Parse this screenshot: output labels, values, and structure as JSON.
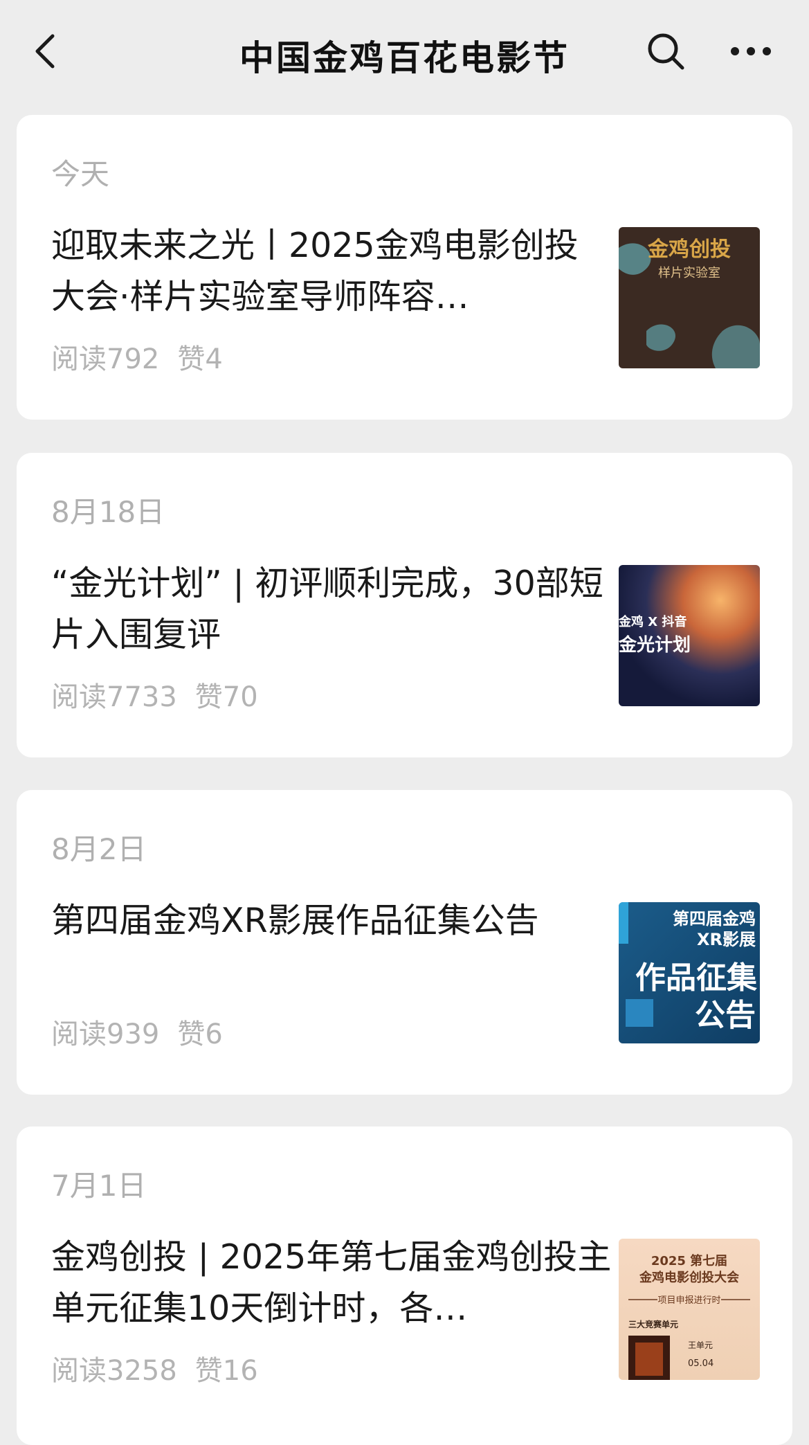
{
  "header": {
    "title": "中国金鸡百花电影节",
    "back_icon": "chevron-left-icon",
    "search_icon": "search-icon",
    "more_icon": "more-dots-icon"
  },
  "articles": [
    {
      "date": "今天",
      "title": "迎取未来之光丨2025金鸡电影创投大会·样片实验室导师阵容…",
      "reads_label": "阅读",
      "reads": "792",
      "likes_label": "赞",
      "likes": "4",
      "thumb": {
        "line1": "金鸡创投",
        "line2": "样片实验室"
      }
    },
    {
      "date": "8月18日",
      "title": "“金光计划” | 初评顺利完成，30部短片入围复评",
      "reads_label": "阅读",
      "reads": "7733",
      "likes_label": "赞",
      "likes": "70",
      "thumb": {
        "line1": "金鸡 X 抖音",
        "line2": "金光计划"
      }
    },
    {
      "date": "8月2日",
      "title": "第四届金鸡XR影展作品征集公告",
      "reads_label": "阅读",
      "reads": "939",
      "likes_label": "赞",
      "likes": "6",
      "thumb": {
        "line1": "第四届金鸡",
        "line2": "XR影展",
        "line3": "作品征集",
        "line4": "公告"
      }
    },
    {
      "date": "7月1日",
      "title": "金鸡创投 | 2025年第七届金鸡创投主单元征集10天倒计时，各…",
      "reads_label": "阅读",
      "reads": "3258",
      "likes_label": "赞",
      "likes": "16",
      "thumb": {
        "line1": "2025 第七届",
        "line2": "金鸡电影创投大会",
        "line3": "项目申报进行时",
        "line4": "三大竞赛单元",
        "line5": "王单元",
        "line6": "05.04"
      }
    }
  ],
  "colors": {
    "background": "#ededed",
    "card": "#ffffff",
    "meta_text": "#b0b0b0",
    "title_text": "#191919"
  }
}
